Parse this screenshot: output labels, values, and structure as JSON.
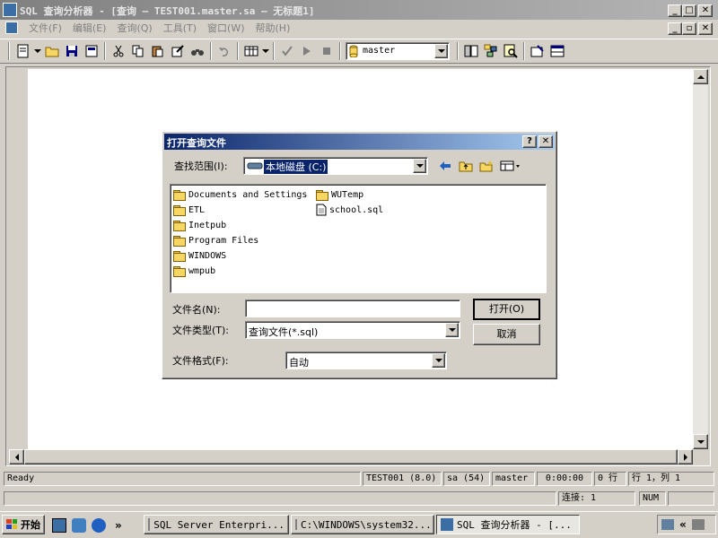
{
  "window": {
    "title": "SQL 查询分析器 - [查询 — TEST001.master.sa — 无标题1]"
  },
  "menu": [
    {
      "label": "文件(F)"
    },
    {
      "label": "编辑(E)"
    },
    {
      "label": "查询(Q)"
    },
    {
      "label": "工具(T)"
    },
    {
      "label": "窗口(W)"
    },
    {
      "label": "帮助(H)"
    }
  ],
  "toolbar": {
    "database": "master"
  },
  "dialog": {
    "title": "打开查询文件",
    "look_in_label": "查找范围(I):",
    "look_in_value": "本地磁盘 (C:)",
    "files": [
      {
        "name": "Documents and Settings",
        "kind": "folder"
      },
      {
        "name": "ETL",
        "kind": "folder"
      },
      {
        "name": "Inetpub",
        "kind": "folder"
      },
      {
        "name": "Program Files",
        "kind": "folder"
      },
      {
        "name": "WINDOWS",
        "kind": "folder"
      },
      {
        "name": "wmpub",
        "kind": "folder"
      },
      {
        "name": "WUTemp",
        "kind": "folder"
      },
      {
        "name": "school.sql",
        "kind": "file"
      }
    ],
    "filename_label": "文件名(N):",
    "filename_value": "",
    "filetype_label": "文件类型(T):",
    "filetype_value": "查询文件(*.sql)",
    "format_label": "文件格式(F):",
    "format_value": "自动",
    "open_button": "打开(O)",
    "cancel_button": "取消"
  },
  "status": {
    "ready": "Ready",
    "server": "TEST001 (8.0)",
    "user": "sa (54)",
    "db": "master",
    "time": "0:00:00",
    "rows": "0 行",
    "position": "行 1，列 1",
    "connections": "连接: 1",
    "num": "NUM"
  },
  "taskbar": {
    "start": "开始",
    "overflow": "»",
    "tasks": [
      {
        "label": "SQL Server Enterpri..."
      },
      {
        "label": "C:\\WINDOWS\\system32..."
      },
      {
        "label": "SQL 查询分析器 - [..."
      }
    ],
    "tray_overflow": "«"
  }
}
